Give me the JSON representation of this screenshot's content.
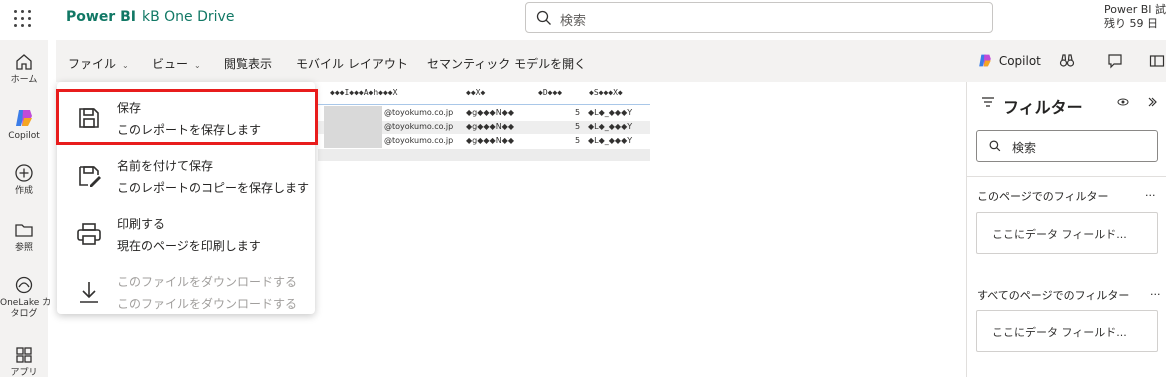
{
  "app": {
    "brand": "Power BI",
    "workspace": "kB One Drive",
    "trial_line1": "Power BI 試",
    "trial_line2": "残り 59 日",
    "accent": "#117865"
  },
  "search": {
    "placeholder": "検索"
  },
  "rail": [
    {
      "label": "ホーム",
      "icon": "home-icon"
    },
    {
      "label": "Copilot",
      "icon": "copilot-icon"
    },
    {
      "label": "作成",
      "icon": "create-icon"
    },
    {
      "label": "参照",
      "icon": "browse-icon"
    },
    {
      "label_line1": "OneLake カ",
      "label_line2": "タログ",
      "icon": "onelake-icon"
    },
    {
      "label": "アプリ",
      "icon": "apps-icon"
    }
  ],
  "ribbon": {
    "tabs": [
      "ファイル",
      "ビュー",
      "閲覧表示",
      "モバイル レイアウト",
      "セマンティック モデルを開く"
    ],
    "copilot": "Copilot"
  },
  "table": {
    "headers": [
      "◆◆◆I◆◆◆A◆h◆◆◆X",
      "◆◆X◆",
      "◆D◆◆◆",
      "◆S◆◆◆X◆"
    ],
    "rows": [
      {
        "email": "@toyokumo.co.jp",
        "name": "◆g◆◆◆N◆◆",
        "num": "5",
        "code": "◆L◆_◆◆◆Y"
      },
      {
        "email": "@toyokumo.co.jp",
        "name": "◆g◆◆◆N◆◆",
        "num": "5",
        "code": "◆L◆_◆◆◆Y"
      },
      {
        "email": "@toyokumo.co.jp",
        "name": "◆g◆◆◆N◆◆",
        "num": "5",
        "code": "◆L◆_◆◆◆Y"
      }
    ]
  },
  "menu": {
    "items": [
      {
        "title": "保存",
        "desc": "このレポートを保存します",
        "icon": "save-icon",
        "enabled": true,
        "highlighted": true
      },
      {
        "title": "名前を付けて保存",
        "desc": "このレポートのコピーを保存します",
        "icon": "save-as-icon",
        "enabled": true
      },
      {
        "title": "印刷する",
        "desc": "現在のページを印刷します",
        "icon": "print-icon",
        "enabled": true
      },
      {
        "title": "このファイルをダウンロードする",
        "desc": "このファイルをダウンロードする",
        "icon": "download-icon",
        "enabled": false
      }
    ]
  },
  "filters": {
    "title": "フィルター",
    "search_placeholder": "検索",
    "page_section": "このページでのフィルター",
    "all_section": "すべてのページでのフィルター",
    "more": "...",
    "drop_hint": "ここにデータ フィールド..."
  },
  "colors": {
    "highlight": "#e81c1c"
  }
}
